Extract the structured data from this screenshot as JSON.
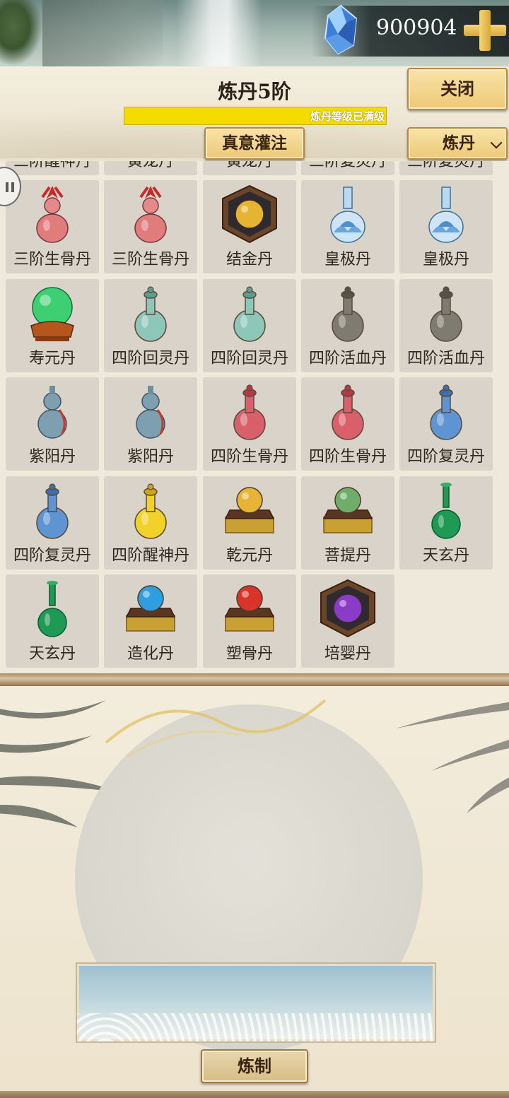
{
  "currency": {
    "icon": "blue-crystal-gem-icon",
    "value": "900904",
    "add_icon": "gold-plus-icon"
  },
  "header": {
    "title": "炼丹5阶",
    "progress_text": "炼丹等级已满级",
    "progress_fraction": 1.0,
    "close_label": "关闭",
    "infuse_label": "真意灌注",
    "dropdown_selected": "炼丹"
  },
  "grid": {
    "partial_row": [
      "三阶醒神丹",
      "黄龙丹",
      "黄龙丹",
      "三阶复灵丹",
      "三阶复灵丹"
    ],
    "items": [
      {
        "name": "三阶生骨丹",
        "icon": "pink-gourd-vase-icon"
      },
      {
        "name": "三阶生骨丹",
        "icon": "pink-gourd-vase-icon"
      },
      {
        "name": "结金丹",
        "icon": "gold-orb-box-icon"
      },
      {
        "name": "皇极丹",
        "icon": "blue-lotus-vase-icon"
      },
      {
        "name": "皇极丹",
        "icon": "blue-lotus-vase-icon"
      },
      {
        "name": "寿元丹",
        "icon": "green-crystal-ball-icon"
      },
      {
        "name": "四阶回灵丹",
        "icon": "teal-bottle-icon"
      },
      {
        "name": "四阶回灵丹",
        "icon": "teal-bottle-icon"
      },
      {
        "name": "四阶活血丹",
        "icon": "gray-bottle-icon"
      },
      {
        "name": "四阶活血丹",
        "icon": "gray-bottle-icon"
      },
      {
        "name": "紫阳丹",
        "icon": "blue-gourd-icon"
      },
      {
        "name": "紫阳丹",
        "icon": "blue-gourd-icon"
      },
      {
        "name": "四阶生骨丹",
        "icon": "red-bottle-icon"
      },
      {
        "name": "四阶生骨丹",
        "icon": "red-bottle-icon"
      },
      {
        "name": "四阶复灵丹",
        "icon": "blue-bottle-icon"
      },
      {
        "name": "四阶复灵丹",
        "icon": "blue-bottle-icon"
      },
      {
        "name": "四阶醒神丹",
        "icon": "yellow-bottle-icon"
      },
      {
        "name": "乾元丹",
        "icon": "gold-orb-stand-icon"
      },
      {
        "name": "菩提丹",
        "icon": "green-orb-stand-icon"
      },
      {
        "name": "天玄丹",
        "icon": "green-vase-icon"
      },
      {
        "name": "天玄丹",
        "icon": "green-vase-icon"
      },
      {
        "name": "造化丹",
        "icon": "blue-orb-stand-icon"
      },
      {
        "name": "塑骨丹",
        "icon": "red-orb-stand-icon"
      },
      {
        "name": "培婴丹",
        "icon": "purple-orb-box-icon"
      }
    ]
  },
  "craft": {
    "label": "炼制"
  },
  "colors": {
    "progress": "#f0d400",
    "button_gold": "#edc978",
    "cell_bg": "#d9d3c9"
  }
}
